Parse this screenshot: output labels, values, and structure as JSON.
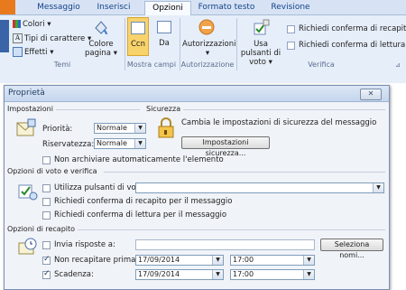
{
  "ribbon": {
    "tabs": [
      "Messaggio",
      "Inserisci",
      "Opzioni",
      "Formato testo",
      "Revisione"
    ],
    "active_tab": "Opzioni",
    "themes_group": {
      "colori": "Colori",
      "tipi_carattere": "Tipi di carattere",
      "effetti": "Effetti",
      "colore_pagina": "Colore pagina",
      "label": "Temi"
    },
    "fields_group": {
      "ccn": "Ccn",
      "da": "Da",
      "label": "Mostra campi"
    },
    "automation_group": {
      "autorizzazioni": "Autorizzazioni",
      "label": "Autorizzazione"
    },
    "tracking_group": {
      "usa_pulsanti_voto": "Usa pulsanti di voto",
      "richiedi_recapito": "Richiedi conferma di recapito",
      "richiedi_lettura": "Richiedi conferma di lettura",
      "label": "Verifica"
    }
  },
  "dialog": {
    "title": "Proprietà",
    "close_label": "✕",
    "impostazioni": {
      "header": "Impostazioni",
      "priorita_label": "Priorità:",
      "priorita_value": "Normale",
      "riservatezza_label": "Riservatezza:",
      "riservatezza_value": "Normale",
      "non_archiviare": "Non archiviare automaticamente l'elemento"
    },
    "sicurezza": {
      "header": "Sicurezza",
      "desc": "Cambia le impostazioni di sicurezza del messaggio",
      "button": "Impostazioni sicurezza..."
    },
    "voto": {
      "header": "Opzioni di voto e verifica",
      "utilizza_pulsanti": "Utilizza pulsanti di voto:",
      "conferma_recapito": "Richiedi conferma di recapito per il messaggio",
      "conferma_lettura": "Richiedi conferma di lettura per il messaggio"
    },
    "recapito": {
      "header": "Opzioni di recapito",
      "invia_risposte": "Invia risposte a:",
      "seleziona_nomi": "Seleziona nomi...",
      "non_recapitare": "Non recapitare prima di:",
      "non_recapitare_date": "17/09/2014",
      "non_recapitare_time": "17:00",
      "scadenza": "Scadenza:",
      "scadenza_date": "17/09/2014",
      "scadenza_time": "17:00"
    }
  }
}
